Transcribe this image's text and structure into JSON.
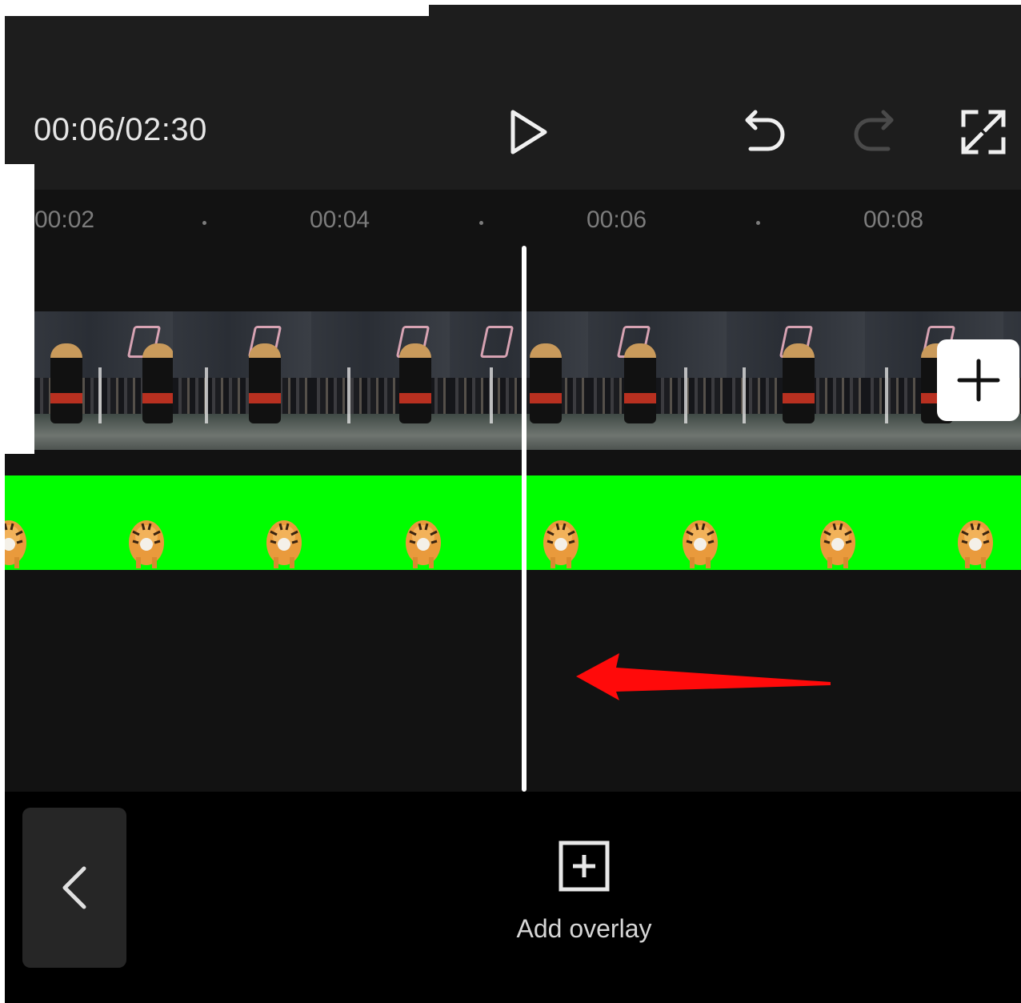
{
  "toolbar": {
    "timecode": "00:06/02:30",
    "play_icon": "play-icon",
    "undo_icon": "undo-icon",
    "redo_icon": "redo-icon",
    "fullscreen_icon": "fullscreen-icon"
  },
  "timeline": {
    "ruler": [
      "00:02",
      "00:04",
      "00:06",
      "00:08"
    ],
    "video_track_icon": "video-frames",
    "overlay_track_color": "#00ff00",
    "add_clip_icon": "plus-icon"
  },
  "annotation": {
    "arrow_color": "#ff0000",
    "arrow_direction": "left"
  },
  "bottom_bar": {
    "back_icon": "chevron-left-icon",
    "add_overlay_icon": "add-square-icon",
    "add_overlay_label": "Add overlay"
  }
}
